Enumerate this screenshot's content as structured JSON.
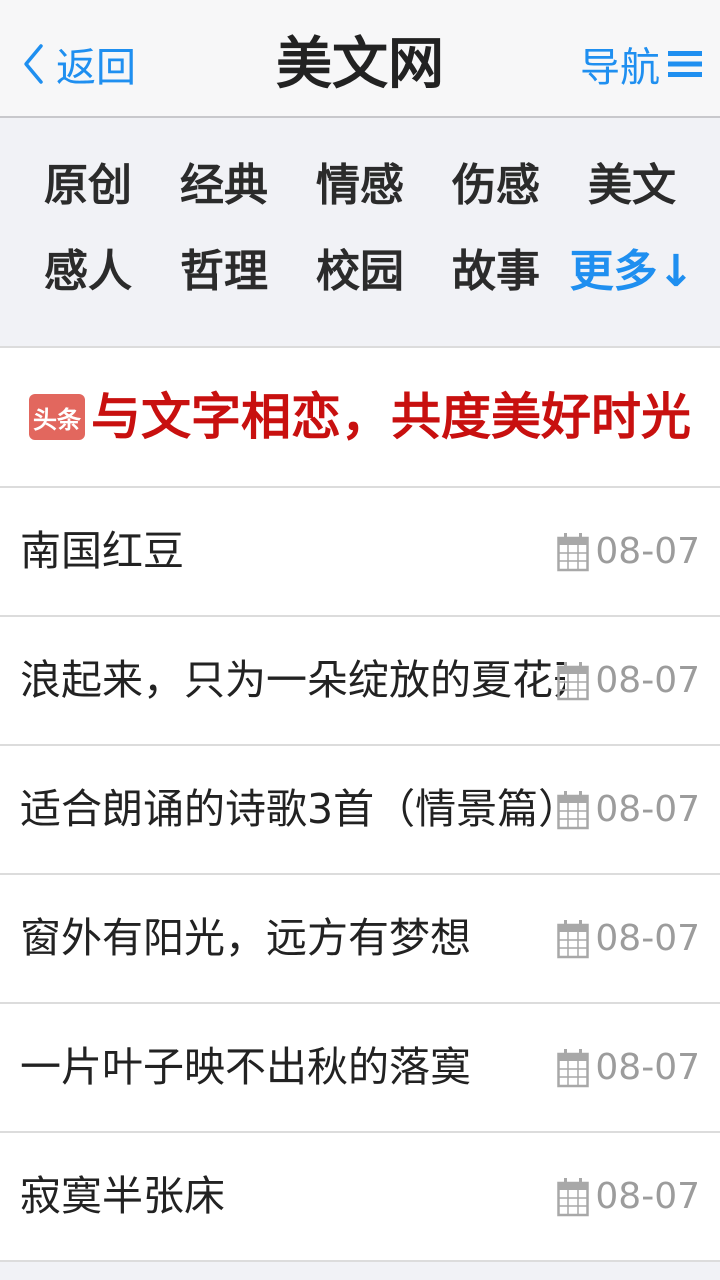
{
  "header": {
    "back_label": "返回",
    "title": "美文网",
    "nav_label": "导航"
  },
  "categories": {
    "row1": [
      "原创",
      "经典",
      "情感",
      "伤感",
      "美文"
    ],
    "row2": [
      "感人",
      "哲理",
      "校园",
      "故事"
    ],
    "more_label": "更多↓"
  },
  "headline": {
    "badge": "头条",
    "text": "与文字相恋，共度美好时光"
  },
  "articles": [
    {
      "title": "南国红豆",
      "date": "08-07"
    },
    {
      "title": "浪起来，只为一朵绽放的夏花开在",
      "date": "08-07"
    },
    {
      "title": "适合朗诵的诗歌3首（情景篇）",
      "date": "08-07"
    },
    {
      "title": "窗外有阳光，远方有梦想",
      "date": "08-07"
    },
    {
      "title": "一片叶子映不出秋的落寞",
      "date": "08-07"
    },
    {
      "title": "寂寞半张床",
      "date": "08-07"
    }
  ],
  "icons": {
    "back": "chevron-left-icon",
    "nav": "menu-icon",
    "date": "calendar-icon"
  },
  "colors": {
    "accent": "#1f8ff0",
    "headline_red": "#c8100f",
    "badge_bg": "#e2675e",
    "date_gray": "#9c9c9c"
  }
}
